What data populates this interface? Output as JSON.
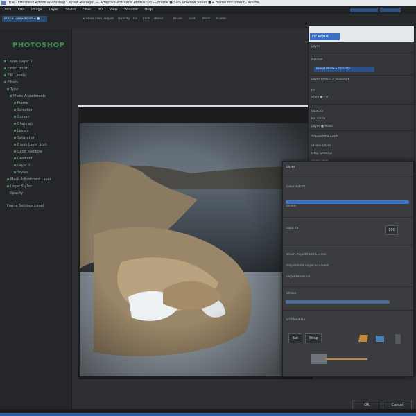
{
  "window": {
    "title": "File  ·  Effortless Adobe Photoshop Layout Manager — Adaptive ProDome Photoshop — Frame ● 50% Preview Sheet ■ ▸ Frame document · Adobe"
  },
  "menu": {
    "items": [
      "Docs",
      "Edit",
      "Image",
      "Layer",
      "Select",
      "Filter",
      "3D",
      "View",
      "Window",
      "Help"
    ]
  },
  "toolbar": {
    "active_tab": "Eras ▸ Live ▸ Brush ▸ ●",
    "items": [
      "▸ Show Files",
      "Adjust",
      "Opacity",
      "Fill",
      "Lock",
      "Blend",
      "Brush",
      "Grid",
      "Mask",
      "Frame"
    ]
  },
  "left_panel": {
    "logo": "PHOTOSHOP",
    "items": [
      "Layer: Layer 1",
      "Filter: Brush",
      "Fill: Levels",
      "Filters",
      "Type",
      "Photo Adjustments",
      "Frame",
      "Selection",
      "Curves",
      "Channels",
      "Levels",
      "Saturation",
      "Brush Layer Split",
      "Color Rainbow",
      "Gradient",
      "Layer 1",
      "Styles",
      "Mask Adjustment Layer",
      "Layer Styles",
      "Opacity",
      "Frame Settings panel"
    ]
  },
  "right_panel": {
    "tab": "Fill  Adjust",
    "rows": [
      "Layer",
      "Normal",
      "Layer Effects ▸ Opacity ▸",
      "Fill",
      "Style  ●  Fill",
      "Opacity",
      "Fill  100%",
      "Layer ● Mask",
      "Adjustment Layer",
      "Stroke Layer",
      "Drop Shadow",
      "Inner Glow",
      "Gradient"
    ],
    "highlight": "Blend Mode ▸ Opacity"
  },
  "dialog": {
    "title": "Layer",
    "rows": [
      "Color Adjust",
      "Levels",
      "Opacity",
      "Brush Adjustment Curves",
      "Adjustment Layer Gradient",
      "Layer Blend Fill",
      "Stroke",
      "Gradient Fill"
    ],
    "opacity_value": "100",
    "buttons": [
      "Sat",
      "Wrap"
    ]
  },
  "bottom": {
    "ok_label": "OK",
    "cancel_label": "Cancel"
  },
  "colors": {
    "accent": "#3a6fc4",
    "highlight": "#2c4f86",
    "green": "#3e8a4a",
    "taskbar": "#2a5fa8"
  }
}
